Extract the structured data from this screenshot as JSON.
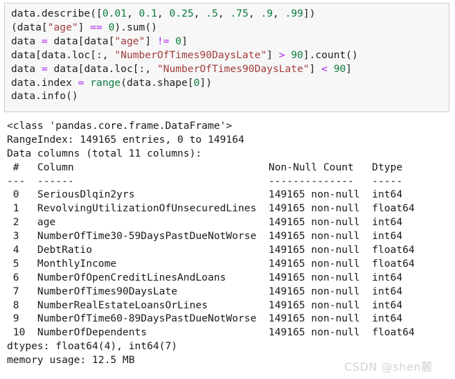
{
  "code_cell": {
    "lines": [
      [
        {
          "t": "data.describe(",
          "c": "plain"
        },
        {
          "t": "[",
          "c": "plain"
        },
        {
          "t": "0.01",
          "c": "num"
        },
        {
          "t": ", ",
          "c": "plain"
        },
        {
          "t": "0.1",
          "c": "num"
        },
        {
          "t": ", ",
          "c": "plain"
        },
        {
          "t": "0.25",
          "c": "num"
        },
        {
          "t": ", ",
          "c": "plain"
        },
        {
          "t": ".5",
          "c": "num"
        },
        {
          "t": ", ",
          "c": "plain"
        },
        {
          "t": ".75",
          "c": "num"
        },
        {
          "t": ", ",
          "c": "plain"
        },
        {
          "t": ".9",
          "c": "num"
        },
        {
          "t": ", ",
          "c": "plain"
        },
        {
          "t": ".99",
          "c": "num"
        },
        {
          "t": "])",
          "c": "plain"
        }
      ],
      [
        {
          "t": "(data[",
          "c": "plain"
        },
        {
          "t": "\"age\"",
          "c": "str"
        },
        {
          "t": "] ",
          "c": "plain"
        },
        {
          "t": "==",
          "c": "op"
        },
        {
          "t": " ",
          "c": "plain"
        },
        {
          "t": "0",
          "c": "num"
        },
        {
          "t": ").sum()",
          "c": "plain"
        }
      ],
      [
        {
          "t": "data ",
          "c": "plain"
        },
        {
          "t": "=",
          "c": "op"
        },
        {
          "t": " data[data[",
          "c": "plain"
        },
        {
          "t": "\"age\"",
          "c": "str"
        },
        {
          "t": "] ",
          "c": "plain"
        },
        {
          "t": "!=",
          "c": "op"
        },
        {
          "t": " ",
          "c": "plain"
        },
        {
          "t": "0",
          "c": "num"
        },
        {
          "t": "]",
          "c": "plain"
        }
      ],
      [
        {
          "t": "data[data.loc[:, ",
          "c": "plain"
        },
        {
          "t": "\"NumberOfTimes90DaysLate\"",
          "c": "str"
        },
        {
          "t": "] ",
          "c": "plain"
        },
        {
          "t": ">",
          "c": "op"
        },
        {
          "t": " ",
          "c": "plain"
        },
        {
          "t": "90",
          "c": "num"
        },
        {
          "t": "].count()",
          "c": "plain"
        }
      ],
      [
        {
          "t": "data ",
          "c": "plain"
        },
        {
          "t": "=",
          "c": "op"
        },
        {
          "t": " data[data.loc[:, ",
          "c": "plain"
        },
        {
          "t": "\"NumberOfTimes90DaysLate\"",
          "c": "str"
        },
        {
          "t": "] ",
          "c": "plain"
        },
        {
          "t": "<",
          "c": "op"
        },
        {
          "t": " ",
          "c": "plain"
        },
        {
          "t": "90",
          "c": "num"
        },
        {
          "t": "]",
          "c": "plain"
        }
      ],
      [
        {
          "t": "data.index ",
          "c": "plain"
        },
        {
          "t": "=",
          "c": "op"
        },
        {
          "t": " ",
          "c": "plain"
        },
        {
          "t": "range",
          "c": "func"
        },
        {
          "t": "(data.shape[",
          "c": "plain"
        },
        {
          "t": "0",
          "c": "num"
        },
        {
          "t": "])",
          "c": "plain"
        }
      ],
      [
        {
          "t": "data.info()",
          "c": "plain"
        }
      ]
    ]
  },
  "output": {
    "header_lines": [
      "<class 'pandas.core.frame.DataFrame'>",
      "RangeIndex: 149165 entries, 0 to 149164",
      "Data columns (total 11 columns):"
    ],
    "table_header": " #   Column                                Non-Null Count   Dtype  ",
    "table_rule": "---  ------                                --------------   -----  ",
    "rows": [
      {
        "index": "0",
        "column": "SeriousDlqin2yrs",
        "non_null": "149165 non-null",
        "dtype": "int64"
      },
      {
        "index": "1",
        "column": "RevolvingUtilizationOfUnsecuredLines",
        "non_null": "149165 non-null",
        "dtype": "float64"
      },
      {
        "index": "2",
        "column": "age",
        "non_null": "149165 non-null",
        "dtype": "int64"
      },
      {
        "index": "3",
        "column": "NumberOfTime30-59DaysPastDueNotWorse",
        "non_null": "149165 non-null",
        "dtype": "int64"
      },
      {
        "index": "4",
        "column": "DebtRatio",
        "non_null": "149165 non-null",
        "dtype": "float64"
      },
      {
        "index": "5",
        "column": "MonthlyIncome",
        "non_null": "149165 non-null",
        "dtype": "float64"
      },
      {
        "index": "6",
        "column": "NumberOfOpenCreditLinesAndLoans",
        "non_null": "149165 non-null",
        "dtype": "int64"
      },
      {
        "index": "7",
        "column": "NumberOfTimes90DaysLate",
        "non_null": "149165 non-null",
        "dtype": "int64"
      },
      {
        "index": "8",
        "column": "NumberRealEstateLoansOrLines",
        "non_null": "149165 non-null",
        "dtype": "int64"
      },
      {
        "index": "9",
        "column": "NumberOfTime60-89DaysPastDueNotWorse",
        "non_null": "149165 non-null",
        "dtype": "int64"
      },
      {
        "index": "10",
        "column": "NumberOfDependents",
        "non_null": "149165 non-null",
        "dtype": "float64"
      }
    ],
    "footer_lines": [
      "dtypes: float64(4), int64(7)",
      "memory usage: 12.5 MB"
    ]
  },
  "watermark": {
    "text": "CSDN @shen麓"
  },
  "colors": {
    "cell_background": "#f7f7f7",
    "cell_border": "#cfcfcf",
    "number_token": "#0a7c3c",
    "string_token": "#a33c3c",
    "operator_token": "#aa22ee",
    "builtin_token": "#0a7c3c",
    "text": "#202020",
    "watermark": "#d2d2d2"
  }
}
